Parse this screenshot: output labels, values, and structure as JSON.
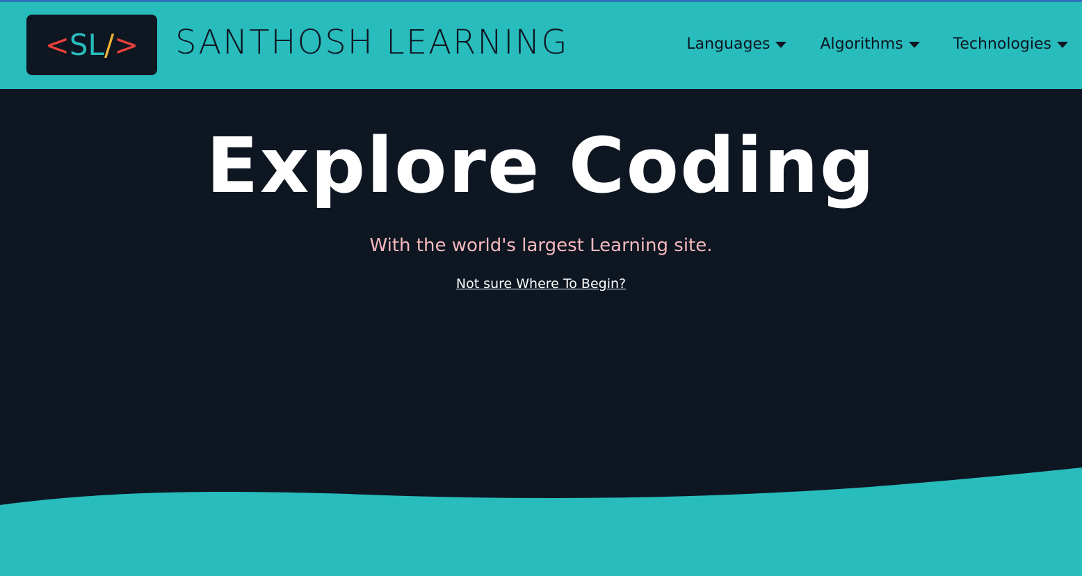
{
  "brand": {
    "logo": {
      "open_bracket": "<",
      "letters": "SL",
      "slash": "/",
      "close_bracket": ">"
    },
    "name": "SANTHOSH LEARNING"
  },
  "nav": {
    "items": [
      {
        "label": "Languages",
        "icon": "caret-down-icon"
      },
      {
        "label": "Algorithms",
        "icon": "caret-down-icon"
      },
      {
        "label": "Technologies",
        "icon": "caret-down-icon"
      }
    ]
  },
  "hero": {
    "title": "Explore Coding",
    "subtitle": "With the world's largest Learning site.",
    "link": "Not sure Where To Begin?"
  },
  "colors": {
    "accent": "#28bcbd",
    "background": "#0d1621",
    "subtitle": "#f7b9be",
    "logo_red": "#e8413b",
    "logo_yellow": "#f2b233"
  }
}
